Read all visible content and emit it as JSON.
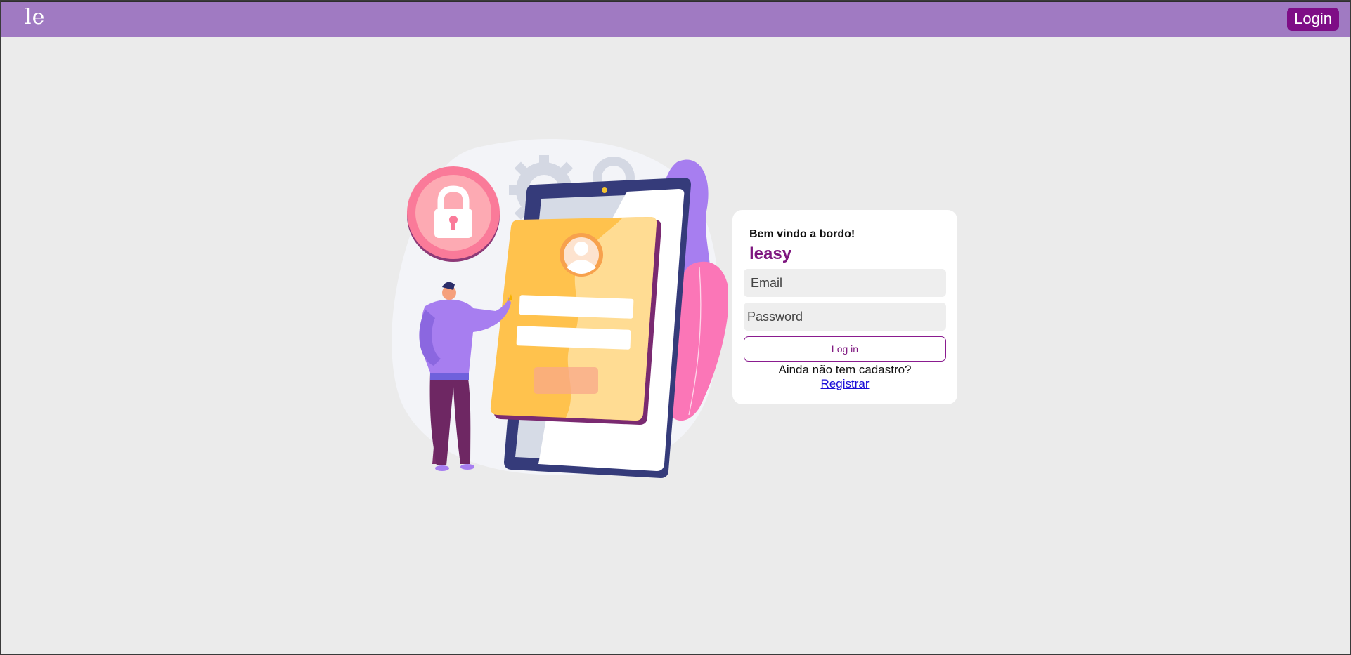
{
  "header": {
    "logo_text": "le",
    "login_label": "Login",
    "color": "#a07ac2",
    "button_color": "#7e0d86"
  },
  "illustration": {
    "icons": [
      "lock-icon",
      "user-icon",
      "gear-icon"
    ]
  },
  "card": {
    "welcome": "Bem vindo a bordo!",
    "brand": "leasy",
    "email_placeholder": "Email",
    "password_placeholder": "Password",
    "login_button": "Log in",
    "no_account_prompt": "Ainda não tem cadastro?",
    "register_link": "Registrar",
    "brand_color": "#7e167f"
  }
}
